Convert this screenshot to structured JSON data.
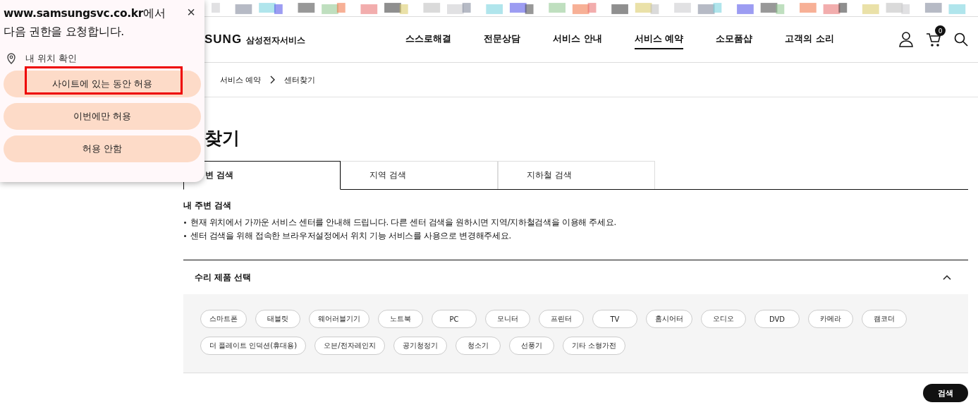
{
  "permission_popup": {
    "message": "**www.samsungsvc.co.kr**에서 다음 권한을 요청합니다.",
    "close": "×",
    "permission": "내 위치 확인",
    "buttons": [
      {
        "label": "사이트에 있는 동안 허용",
        "highlighted": true
      },
      {
        "label": "이번에만 허용",
        "highlighted": false
      },
      {
        "label": "허용 안함",
        "highlighted": false
      }
    ]
  },
  "header": {
    "logo": "SUNG",
    "logo_sub": "삼성전자서비스",
    "nav": [
      {
        "label": "스스로해결",
        "selected": false
      },
      {
        "label": "전문상담",
        "selected": false
      },
      {
        "label": "서비스 안내",
        "selected": false
      },
      {
        "label": "서비스 예약",
        "selected": true
      },
      {
        "label": "소모품샵",
        "selected": false
      },
      {
        "label": "고객의 소리",
        "selected": false
      }
    ],
    "cart_count": "0"
  },
  "breadcrumb": [
    "서비스 예약",
    "센터찾기"
  ],
  "page_title": "찾기",
  "tabs": [
    {
      "label": "변 검색",
      "selected": true
    },
    {
      "label": "지역 검색",
      "selected": false
    },
    {
      "label": "지하철 검색",
      "selected": false
    }
  ],
  "info": {
    "heading": "내 주변 검색",
    "bullets": [
      "현재 위치에서 가까운 서비스 센터를 안내해 드립니다. 다른 센터 검색을 원하시면 지역/지하철검색을 이용해 주세요.",
      "센터 검색을 위해 접속한 브라우저설정에서 위치 기능 서비스를 사용으로 변경해주세요."
    ]
  },
  "product_select": {
    "title": "수리 제품 선택",
    "expanded": true,
    "products": [
      "스마트폰",
      "태블릿",
      "웨어러블기기",
      "노트북",
      "PC",
      "모니터",
      "프린터",
      "TV",
      "홈시어터",
      "오디오",
      "DVD",
      "카메라",
      "캠코더",
      "더 플레이트 인덕션(휴대용)",
      "오븐/전자레인지",
      "공기청정기",
      "청소기",
      "선풍기",
      "기타 소형가전"
    ]
  },
  "search_button": "검색"
}
